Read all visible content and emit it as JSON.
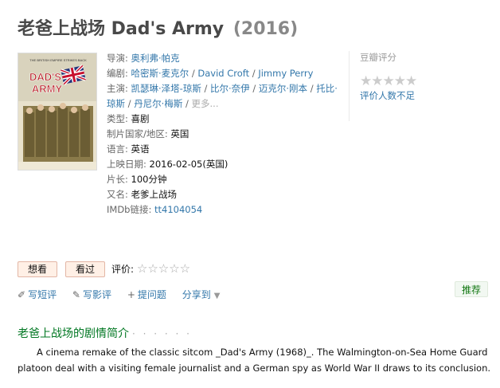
{
  "header": {
    "title": "老爸上战场 Dad's Army",
    "year": "(2016)"
  },
  "poster": {
    "tagline": "THE BRITISH EMPIRE STRIKES BACK",
    "logo_line1": "DAD'S",
    "logo_line2": "ARMY",
    "alt": "poster-image"
  },
  "info": {
    "director_label": "导演:",
    "director": "奥利弗·帕克",
    "writer_label": "编剧:",
    "writers": [
      "哈密斯·麦克尔",
      "David Croft",
      "Jimmy Perry"
    ],
    "cast_label": "主演:",
    "cast": [
      "凯瑟琳·泽塔-琼斯",
      "比尔·奈伊",
      "迈克尔·刚本",
      "托比·琼斯",
      "丹尼尔·梅斯"
    ],
    "cast_more": "更多...",
    "genre_label": "类型:",
    "genre": "喜剧",
    "country_label": "制片国家/地区:",
    "country": "英国",
    "language_label": "语言:",
    "language": "英语",
    "release_label": "上映日期:",
    "release": "2016-02-05(英国)",
    "runtime_label": "片长:",
    "runtime": "100分钟",
    "aka_label": "又名:",
    "aka": "老爹上战场",
    "imdb_label": "IMDb链接:",
    "imdb": "tt4104054"
  },
  "rating": {
    "title": "豆瓣评分",
    "stars": "★★★★★",
    "not_enough": "评价人数不足"
  },
  "interest": {
    "want": "想看",
    "seen": "看过",
    "rate_label": "评价:",
    "rate_stars": "☆☆☆☆☆"
  },
  "actions": {
    "short_review": "写短评",
    "review": "写影评",
    "question": "提问题",
    "share": "分享到"
  },
  "recommend": "推荐",
  "synopsis": {
    "title": "老爸上战场的剧情简介",
    "dots": "· · · · · ·",
    "text": "A cinema remake of the classic sitcom _Dad's Army (1968)_. The Walmington-on-Sea Home Guard platoon deal with a visiting female journalist and a German spy as World War II draws to its conclusion."
  }
}
